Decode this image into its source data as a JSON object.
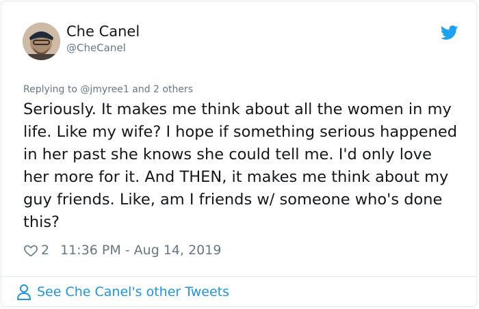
{
  "author": {
    "name": "Che Canel",
    "handle": "@CheCanel"
  },
  "reply_context": {
    "prefix": "Replying to ",
    "handle": "@jmyree1",
    "suffix": " and 2 others"
  },
  "tweet": {
    "text": "Seriously. It makes me think about all the women in my life. Like my wife? I hope if something serious happened in her past she knows she could tell me. I'd only love her more for it. And THEN, it makes me think about my guy friends. Like, am I friends w/ someone who's done this?",
    "like_count": "2",
    "timestamp": "11:36 PM - Aug 14, 2019"
  },
  "footer": {
    "link_text": "See Che Canel's other Tweets"
  },
  "colors": {
    "text": "#14171a",
    "secondary": "#657786",
    "accent": "#1b95e0",
    "border": "#e1e8ed"
  },
  "icons": {
    "brand": "twitter-bird-icon",
    "like": "heart-icon",
    "profile": "person-icon"
  }
}
